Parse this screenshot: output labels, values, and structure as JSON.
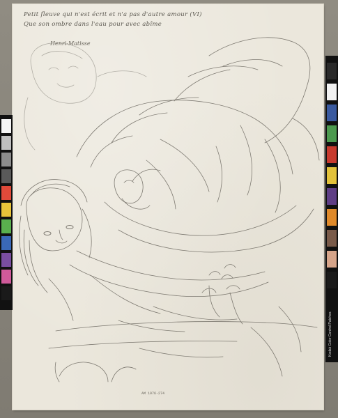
{
  "artwork": {
    "inscription_line1": "Petit fleuve qui n'est écrit et n'a pas d'autre amour (VI)",
    "inscription_line2": "Que son ombre dans l'eau pour avec abîme",
    "signature": "Henri-Matisse",
    "inventory_number": "AM 1976-274",
    "paper_color": "#ebe7dc",
    "pencil_color": "#6b675f"
  },
  "color_checker": {
    "right_label": "Kodak Color Control Patches",
    "right_patches": [
      "#2a2a2a",
      "#f1f1f1",
      "#3a5aa0",
      "#4c9a4f",
      "#c83a2e",
      "#e3c23a",
      "#5f3e86",
      "#e08a2a",
      "#7a5b4a",
      "#d7a58a",
      "#1a1a1a"
    ],
    "left_patches": [
      "#f4f4f4",
      "#bfbfbf",
      "#8c8c8c",
      "#5a5a5a",
      "#e04a3a",
      "#e9c43a",
      "#5ab04e",
      "#3a68b8",
      "#7a4ea0",
      "#d05a9a",
      "#1a1a1a"
    ]
  }
}
